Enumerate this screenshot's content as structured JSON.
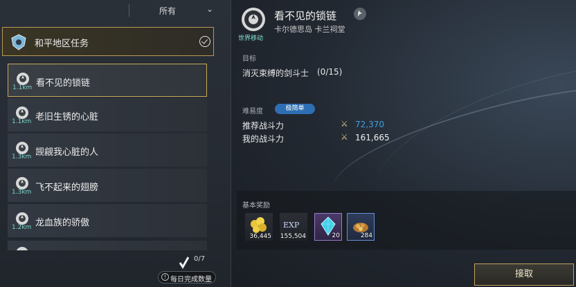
{
  "filter": {
    "selected": "所有"
  },
  "region": {
    "title": "和平地区任务"
  },
  "quests": [
    {
      "name": "看不见的锁链",
      "distance": "1.1km",
      "selected": true
    },
    {
      "name": "老旧生锈的心脏",
      "distance": "1.1km",
      "selected": false
    },
    {
      "name": "觊觎我心脏的人",
      "distance": "1.3km",
      "selected": false
    },
    {
      "name": "飞不起来的翅膀",
      "distance": "1.3km",
      "selected": false
    },
    {
      "name": "龙血族的骄傲",
      "distance": "1.2km",
      "selected": false
    }
  ],
  "daily": {
    "count": "0/7",
    "label": "每日完成数量"
  },
  "detail": {
    "title": "看不见的锁链",
    "tag": "世界移动",
    "location": "卡尔德思岛 卡兰祠堂",
    "goal_label": "目标",
    "goal_text": "消灭束缚的剑斗士",
    "goal_count": "(0/15)",
    "difficulty_label": "难易度",
    "difficulty": "极简单",
    "recommended_label": "推荐战斗力",
    "recommended_value": "72,370",
    "recommended_color": "#3f9fe0",
    "my_label": "我的战斗力",
    "my_value": "161,665",
    "my_color": "#f2f2f2"
  },
  "rewards": {
    "label": "基本奖励",
    "items": [
      {
        "icon": "gold-coins-icon",
        "qty": "36,445"
      },
      {
        "icon": "exp-icon",
        "text": "EXP",
        "qty": "155,504"
      },
      {
        "icon": "blue-crystal-icon",
        "qty": "20"
      },
      {
        "icon": "gold-ore-icon",
        "qty": "284"
      }
    ]
  },
  "accept_button": "接取"
}
